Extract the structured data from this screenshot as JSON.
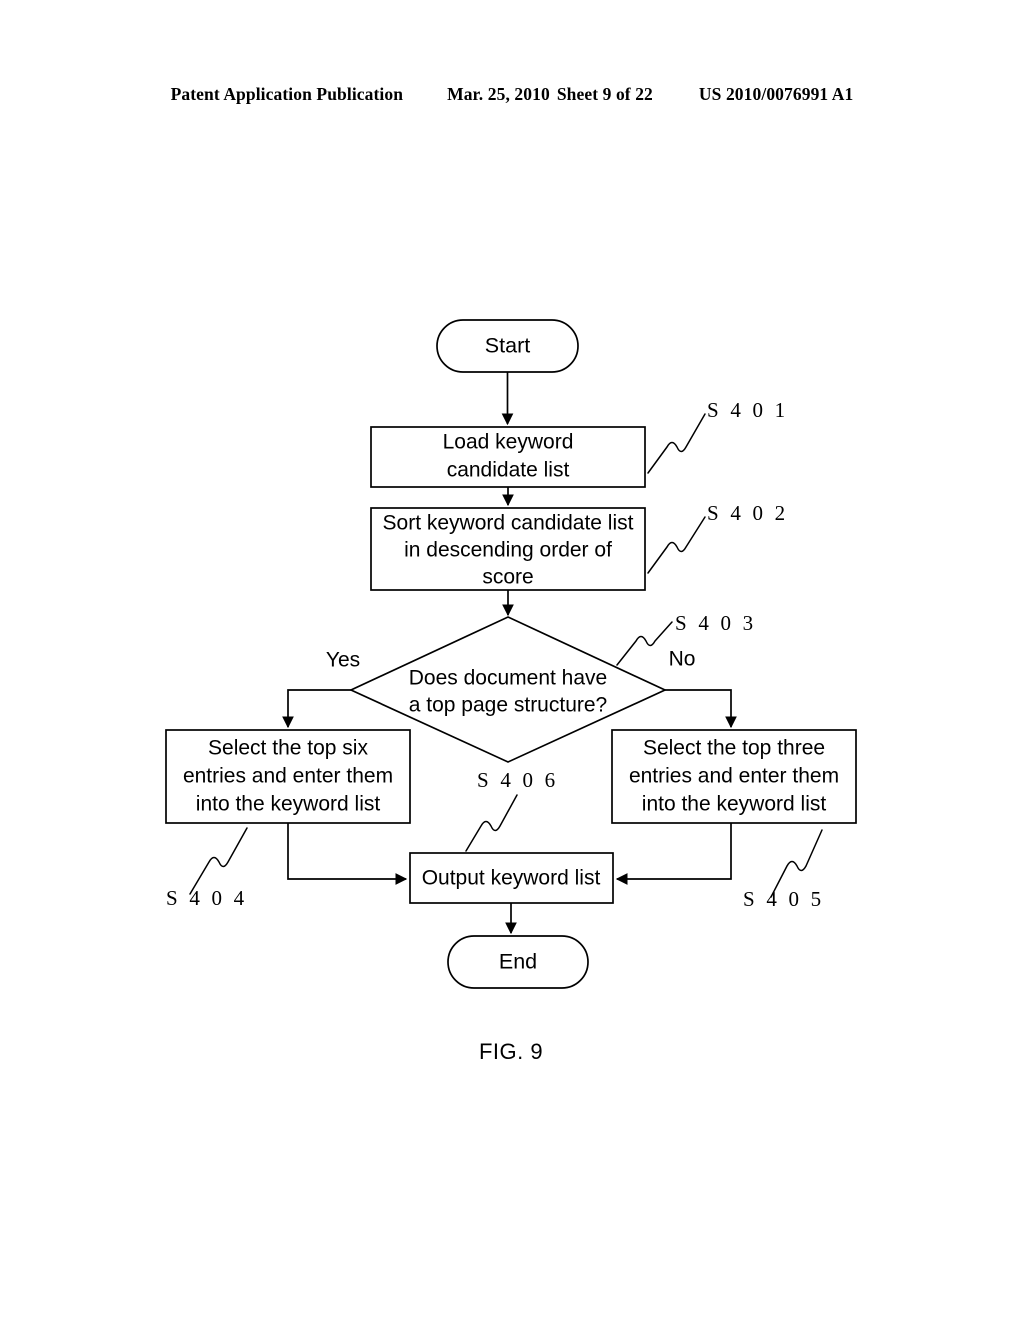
{
  "header": {
    "publication": "Patent Application Publication",
    "date": "Mar. 25, 2010",
    "sheet": "Sheet 9 of 22",
    "patent_number": "US 2010/0076991 A1"
  },
  "figure": {
    "caption": "FIG. 9"
  },
  "flowchart": {
    "start": {
      "label": "Start"
    },
    "end": {
      "label": "End"
    },
    "steps": [
      {
        "id": "S401",
        "step_label": "S 4 0 1",
        "lines": [
          "Load keyword",
          "candidate list"
        ]
      },
      {
        "id": "S402",
        "step_label": "S 4 0 2",
        "lines": [
          "Sort keyword candidate list",
          "in descending order of",
          "score"
        ]
      },
      {
        "id": "S403",
        "step_label": "S 4 0 3",
        "lines": [
          "Does document have",
          "a top page structure?"
        ],
        "yes_label": "Yes",
        "no_label": "No"
      },
      {
        "id": "S404",
        "step_label": "S 4 0 4",
        "lines": [
          "Select the top six",
          "entries and enter them",
          "into the keyword list"
        ]
      },
      {
        "id": "S405",
        "step_label": "S 4 0 5",
        "lines": [
          "Select the top three",
          "entries and enter them",
          "into the keyword list"
        ]
      },
      {
        "id": "S406",
        "step_label": "S 4 0 6",
        "lines": [
          "Output keyword list"
        ]
      }
    ]
  }
}
